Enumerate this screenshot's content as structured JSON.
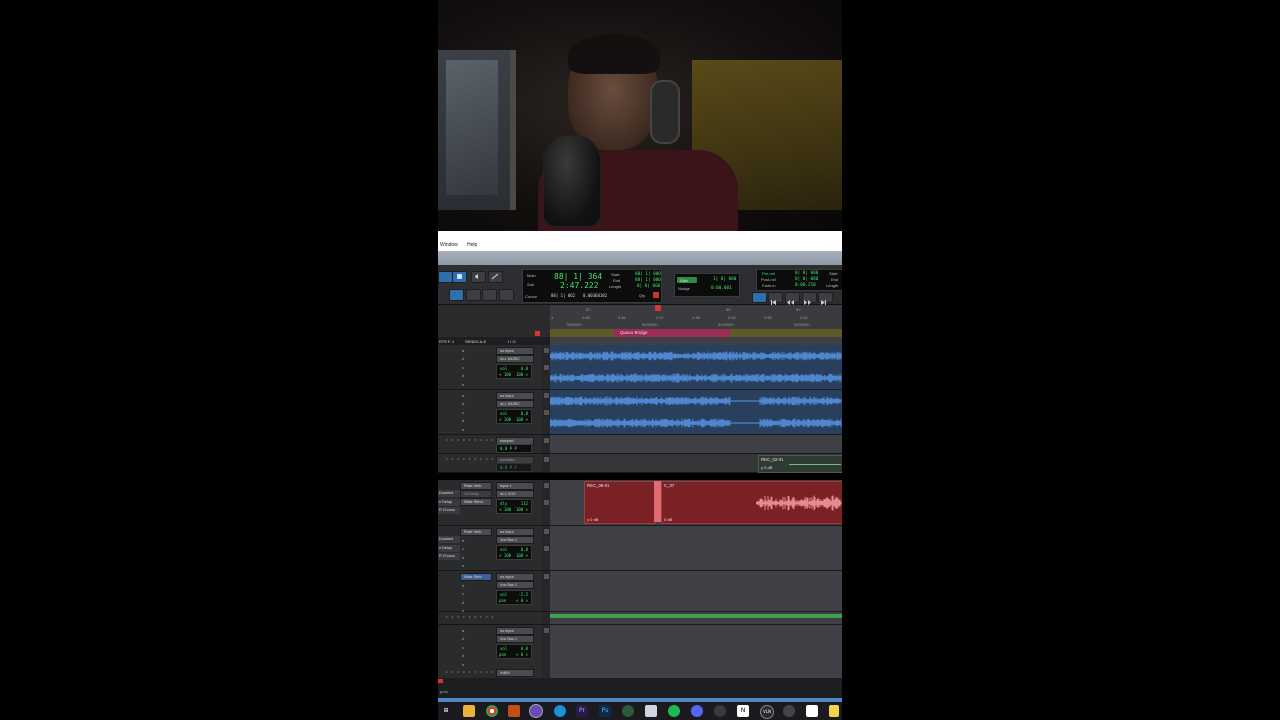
{
  "menubar": {
    "items": [
      "Window",
      "Help"
    ]
  },
  "counter": {
    "main_label": "Main",
    "main_value": "88| 1| 364",
    "sub_label": "Sub",
    "sub_value": "2:47.222",
    "cursor_label": "Cursor",
    "cursor_value": "88| 1| 062",
    "cursor_extra": "0.00360182",
    "start_label": "Start",
    "start_value": "88| 1| 000",
    "end_label": "End",
    "end_value": "88| 1| 000",
    "length_label": "Length",
    "length_value": "0| 0| 000",
    "qty_label": "Qty"
  },
  "edit": {
    "grid_label": "Grid",
    "grid_value": "1| 0| 000",
    "nudge_label": "Nudge",
    "nudge_value": "0:00.001"
  },
  "preroll": {
    "pre_label": "Pre-roll",
    "pre_value": "0| 0| 000",
    "post_label": "Post-roll",
    "post_value": "0| 0| 000",
    "fade_label": "Fade-in",
    "fade_value": "0:00.250",
    "start_label": "Start",
    "end_label": "End",
    "length_label": "Length"
  },
  "ruler": {
    "bars": [
      "87",
      "88",
      "89",
      "90"
    ],
    "times": [
      "2:45",
      "2:46",
      "2:47",
      "2:48",
      "2:49",
      "2:50",
      "2:51"
    ],
    "samples": [
      "7560000",
      "5000000",
      "5100000",
      "5200000"
    ]
  },
  "markers": {
    "name": "Quavo Bridge"
  },
  "columns": {
    "inserts": "RTS F-J",
    "sends": "SENDS A-E",
    "io": "I / O"
  },
  "tracks": {
    "music1": {
      "input": "no input",
      "output": "ALL MUSIC",
      "vol_label": "vol",
      "vol": "0.0",
      "pan_l": "< 100",
      "pan_r": "100 >"
    },
    "music2": {
      "input": "no input",
      "output": "ALL MUSIC",
      "vol_label": "vol",
      "vol": "0.0",
      "pan_l": "< 100",
      "pan_r": "100 >"
    },
    "aux1": {
      "input": "nompsd",
      "output": "ECHO",
      "vals": "0.0  P  P"
    },
    "aux2": {
      "input": "nrenalee",
      "output": "Vnlte",
      "vals": "0.0  P  F"
    },
    "vocal_main": {
      "inserts": [
        "Plate Verb",
        "1s Delay",
        "Wide Stmd"
      ],
      "left_labels": [
        "Doubled",
        "n Delay",
        "R Chorus"
      ],
      "input": "Input 1",
      "output": "ALL VOX",
      "vol_label": "dly",
      "vol": "112",
      "pan_l": "< 100",
      "pan_r": "100 >"
    },
    "vocal_bus": {
      "inserts": [
        "Plate Verb"
      ],
      "left_labels": [
        "Doubled",
        "n Delay",
        "R Chorus"
      ],
      "input": "no input",
      "output": "Vox Bus 1",
      "vol_label": "vol",
      "vol": "0.0",
      "pan_l": "< 100",
      "pan_r": "100 >"
    },
    "wide": {
      "inserts": [
        "Wide Strid"
      ],
      "input": "no input",
      "output": "Vox Bus 1",
      "vol_label": "vol",
      "vol": "-2.5",
      "pan_label": "pan",
      "pan": "< 0 >"
    },
    "last": {
      "input": "no input",
      "output": "Vox Bus 1",
      "vol_label": "vol",
      "vol": "0.0",
      "pan_label": "pan",
      "pan": "< 0 >"
    },
    "last_output2": "VoBH"
  },
  "regions": {
    "rec_main": "REC_06-01",
    "rec_main_db": "γ 0 dB",
    "rec_cut": "C_07",
    "rec_cut_db": "0 dB",
    "rec_side": "REC_02-01",
    "rec_side_db": "γ 0 dB"
  },
  "status": {
    "left": "pros"
  },
  "taskbar": {
    "labels": [
      "Pr",
      "Ps",
      "N",
      "VLN"
    ]
  },
  "colors": {
    "cursor": "#ffffff",
    "marker": "#9c2d52",
    "vox_region": "#7a2125",
    "wave_blue": "#4f86cf",
    "counter_green": "#3ee86b"
  }
}
